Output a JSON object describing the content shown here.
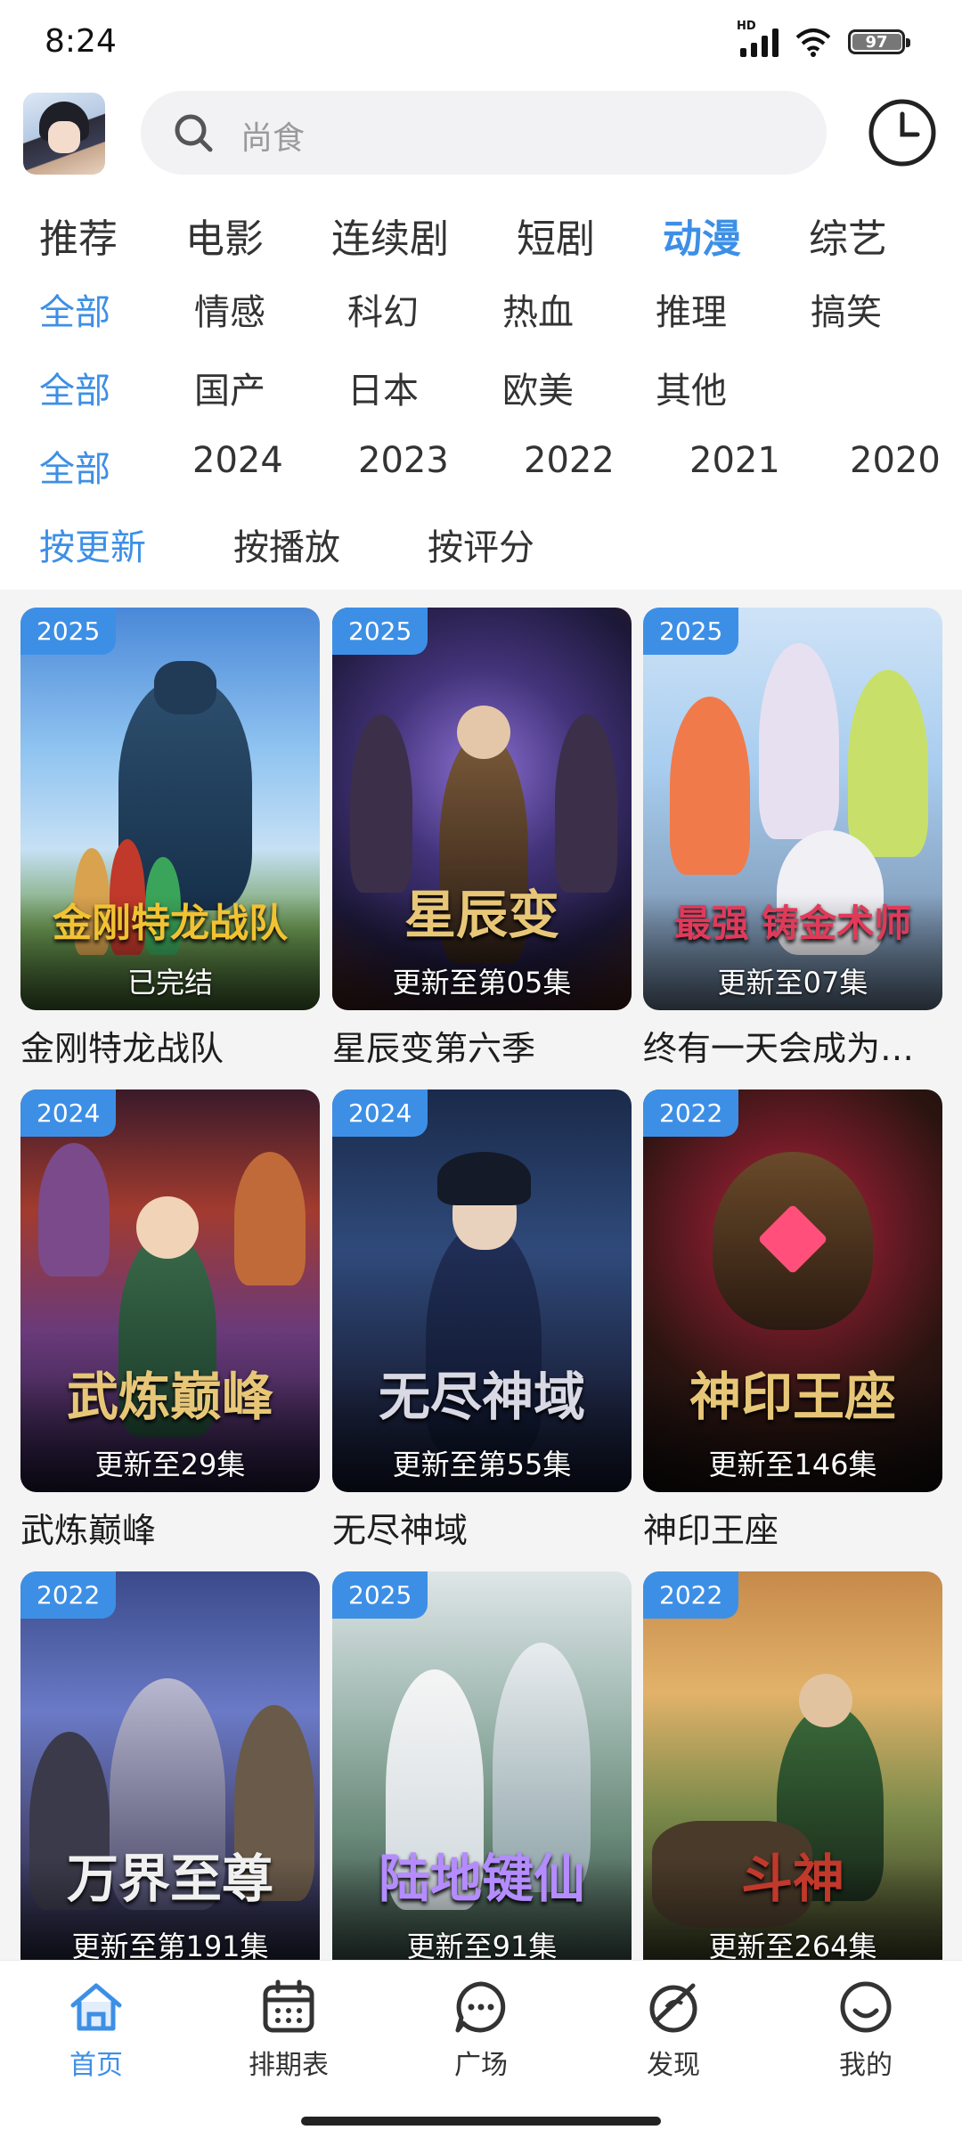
{
  "status_bar": {
    "time": "8:24",
    "network": "HD",
    "battery": "97"
  },
  "header": {
    "search_placeholder": "尚食"
  },
  "top_tabs": [
    "推荐",
    "电影",
    "连续剧",
    "短剧",
    "动漫",
    "综艺"
  ],
  "top_tab_active": "动漫",
  "filters": {
    "genre": [
      "全部",
      "情感",
      "科幻",
      "热血",
      "推理",
      "搞笑"
    ],
    "region": [
      "全部",
      "国产",
      "日本",
      "欧美",
      "其他"
    ],
    "year": [
      "全部",
      "2024",
      "2023",
      "2022",
      "2021",
      "2020"
    ],
    "sort": [
      "按更新",
      "按播放",
      "按评分"
    ]
  },
  "cards": [
    {
      "year": "2025",
      "status": "已完结",
      "title": "金刚特龙战队",
      "logo": "金刚特龙战队"
    },
    {
      "year": "2025",
      "status": "更新至第05集",
      "title": "星辰变第六季",
      "logo": "星辰变"
    },
    {
      "year": "2025",
      "status": "更新至07集",
      "title": "终有一天会成为…",
      "logo": "最强 铸金术师"
    },
    {
      "year": "2024",
      "status": "更新至29集",
      "title": "武炼巅峰",
      "logo": "武炼巅峰"
    },
    {
      "year": "2024",
      "status": "更新至第55集",
      "title": "无尽神域",
      "logo": "无尽神域"
    },
    {
      "year": "2022",
      "status": "更新至146集",
      "title": "神印王座",
      "logo": "神印王座"
    },
    {
      "year": "2022",
      "status": "更新至第191集",
      "title": "",
      "logo": "万界至尊"
    },
    {
      "year": "2025",
      "status": "更新至91集",
      "title": "",
      "logo": "陆地键仙"
    },
    {
      "year": "2022",
      "status": "更新至264集",
      "title": "",
      "logo": "斗神"
    }
  ],
  "bottom_nav": [
    {
      "label": "首页",
      "icon": "home-icon"
    },
    {
      "label": "排期表",
      "icon": "calendar-icon"
    },
    {
      "label": "广场",
      "icon": "chat-icon"
    },
    {
      "label": "发现",
      "icon": "discover-icon"
    },
    {
      "label": "我的",
      "icon": "smile-icon"
    }
  ],
  "colors": {
    "accent": "#3d8fe6",
    "background": "#f4f4f4"
  }
}
